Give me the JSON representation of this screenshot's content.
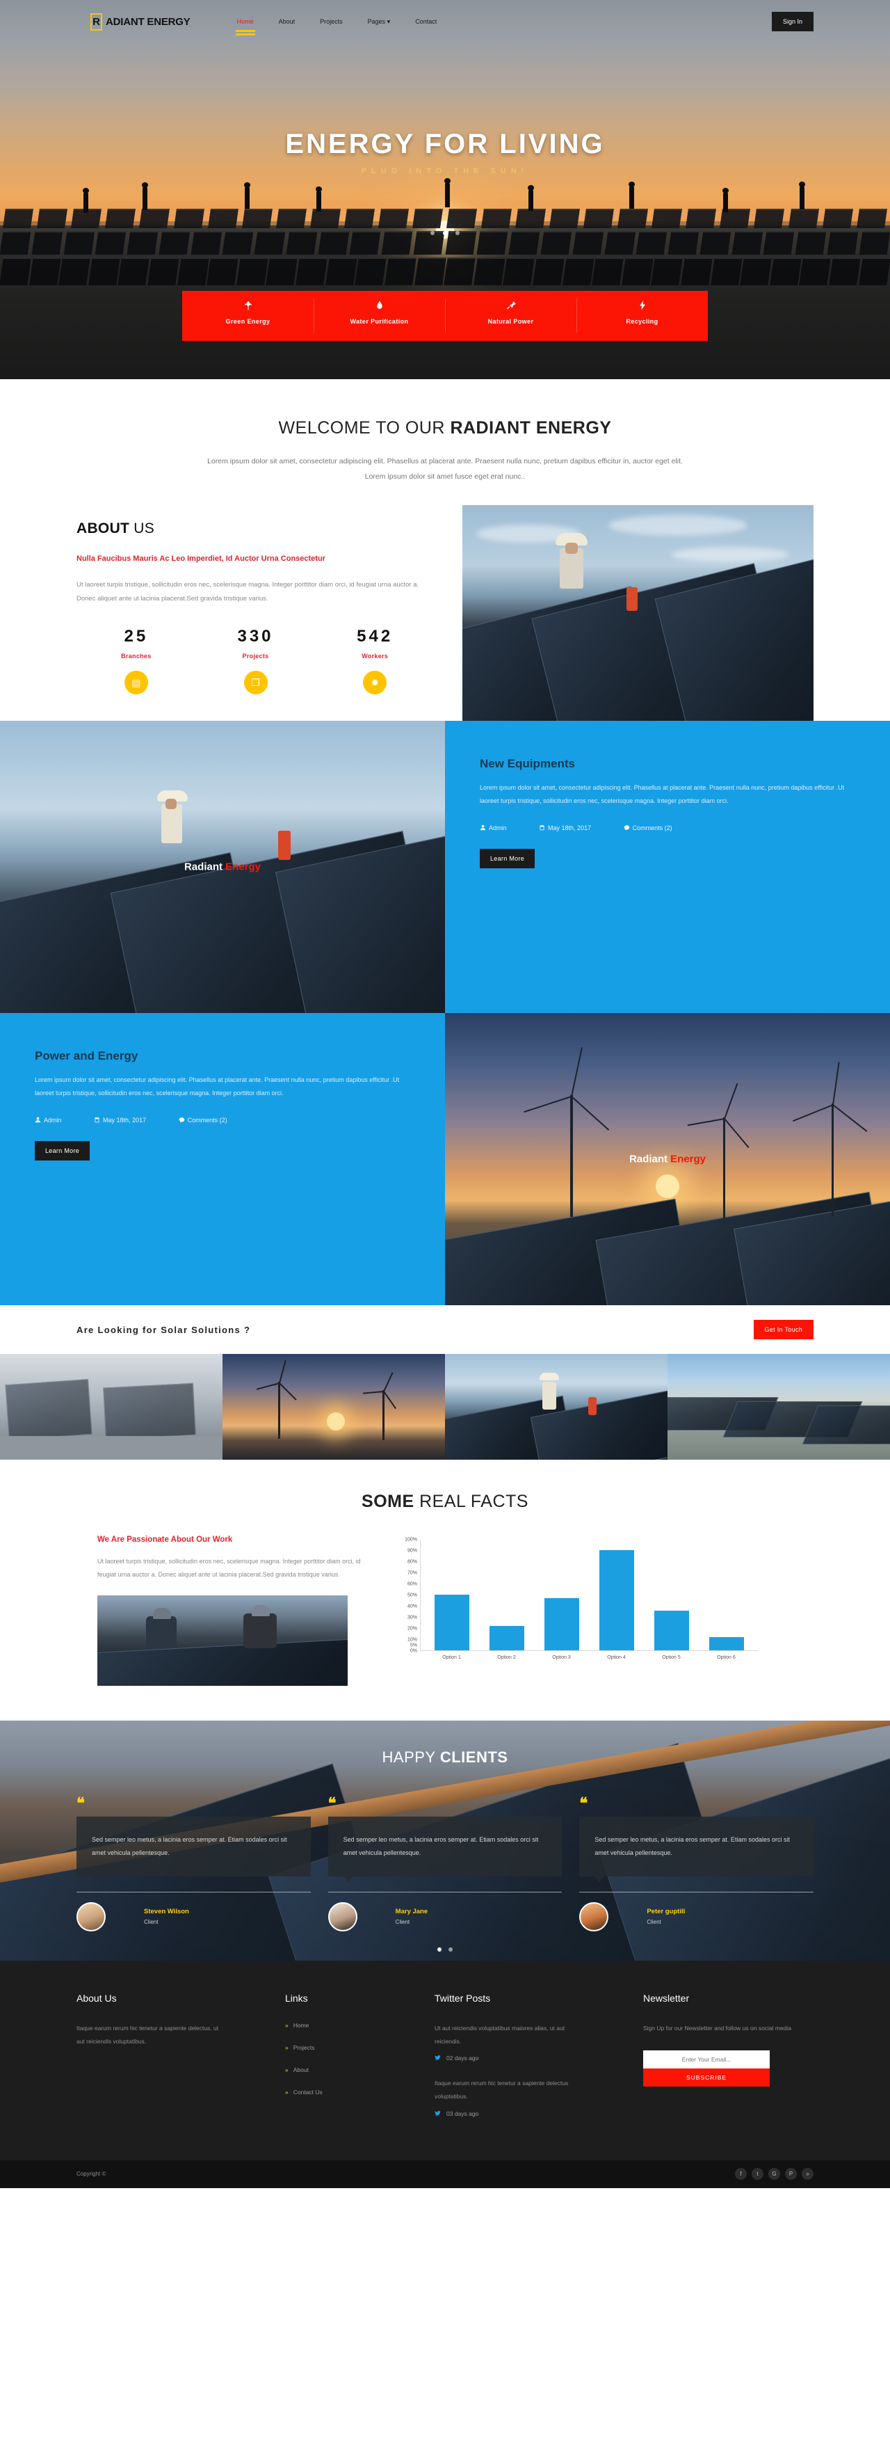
{
  "brand": {
    "initial": "R",
    "rest": "ADIANT ENERGY"
  },
  "nav": {
    "items": [
      {
        "label": "Home",
        "active": true
      },
      {
        "label": "About",
        "active": false
      },
      {
        "label": "Projects",
        "active": false
      },
      {
        "label": "Pages ▾",
        "active": false
      },
      {
        "label": "Contact",
        "active": false
      }
    ],
    "signin": "Sign In"
  },
  "hero": {
    "title": "ENERGY FOR LIVING",
    "subtitle": "PLUG INTO THE SUN!"
  },
  "features": [
    {
      "label": "Green Energy",
      "icon": "leaf-icon"
    },
    {
      "label": "Water Purification",
      "icon": "droplet-icon"
    },
    {
      "label": "Natural Power",
      "icon": "plug-icon"
    },
    {
      "label": "Recycling",
      "icon": "bolt-icon"
    }
  ],
  "welcome": {
    "title_light": "WELCOME TO OUR ",
    "title_bold": "RADIANT ENERGY",
    "body": "Lorem ipsum dolor sit amet, consectetur adipiscing elit. Phasellus at placerat ante. Praesent nulla nunc, pretium dapibus efficitur in, auctor eget elit. Lorem ipsum dolor sit amet fusce eget erat nunc.."
  },
  "about": {
    "title_bold": "ABOUT",
    "title_light": " US",
    "subtitle": "Nulla Faucibus Mauris Ac Leo Imperdiet, Id Auctor Urna Consectetur",
    "body": "Ut laoreet turpis tristique, sollicitudin eros nec, scelerisque magna. Integer porttitor diam orci, id feugiat urna auctor a. Donec aliquet ante ut lacinia placerat.Sed gravida tristique varius.",
    "stats": [
      {
        "number": "25",
        "label": "Branches",
        "icon": "building-icon",
        "glyph": "▤"
      },
      {
        "number": "330",
        "label": "Projects",
        "icon": "briefcase-icon",
        "glyph": "❐"
      },
      {
        "number": "542",
        "label": "Workers",
        "icon": "gear-icon",
        "glyph": "✹"
      }
    ]
  },
  "posts": [
    {
      "title": "New Equipments",
      "body": "Lorem ipsum dolor sit amet, consectetur adipiscing elit. Phasellus at placerat ante. Praesent nulla nunc, pretium dapibus efficitur .Ut laoreet turpis tristique, sollicitudin eros nec, scelerisque magna. Integer porttitor diam orci.",
      "author": "Admin",
      "date": "May 18th, 2017",
      "comments": "Comments (2)",
      "button": "Learn More",
      "image_caption_light": "Radiant ",
      "image_caption_red": "Energy"
    },
    {
      "title": "Power and Energy",
      "body": "Lorem ipsum dolor sit amet, consectetur adipiscing elit. Phasellus at placerat ante. Praesent nulla nunc, pretium dapibus efficitur .Ut laoreet turpis tristique, sollicitudin eros nec, scelerisque magna. Integer porttitor diam orci.",
      "author": "Admin",
      "date": "May 18th, 2017",
      "comments": "Comments (2)",
      "button": "Learn More",
      "image_caption_light": "Radiant ",
      "image_caption_red": "Energy"
    }
  ],
  "cta": {
    "heading": "Are Looking for Solar Solutions ?",
    "button": "Get In Touch"
  },
  "facts": {
    "title_bold": "SOME",
    "title_light": " REAL FACTS",
    "heading": "We Are Passionate About Our Work",
    "body": "Ut laoreet turpis tristique, sollicitudin eros nec, scelerisque magna. Integer porttitor diam orci, id feugiat urna auctor a. Donec aliquet ante ut lacinia placerat.Sed gravida tristique varius."
  },
  "chart_data": {
    "type": "bar",
    "title": "",
    "categories": [
      "Option 1",
      "Option 2",
      "Option 3",
      "Option 4",
      "Option 5",
      "Option 6"
    ],
    "values": [
      50,
      22,
      47,
      90,
      36,
      12
    ],
    "series": [
      {
        "name": "Percentage",
        "values": [
          50,
          22,
          47,
          90,
          36,
          12
        ]
      }
    ],
    "ylabel": "",
    "xlabel": "",
    "ylim": [
      0,
      100
    ],
    "yticks": [
      "100%",
      "90%",
      "80%",
      "70%",
      "60%",
      "50%",
      "40%",
      "30%",
      "20%",
      "10%",
      "5%"
    ],
    "ytick_values": [
      100,
      90,
      80,
      70,
      60,
      50,
      40,
      30,
      20,
      10,
      5
    ],
    "bar_color": "#1c9fe0",
    "grid": false,
    "legend": "none"
  },
  "testimonials": {
    "title_light": "HAPPY ",
    "title_bold": "CLIENTS",
    "quote_glyph": "❝",
    "items": [
      {
        "text": "Sed semper leo metus, a lacinia eros semper at. Etiam sodales orci sit amet vehicula pellentesque.",
        "name": "Steven Wilson",
        "role": "Client"
      },
      {
        "text": "Sed semper leo metus, a lacinia eros semper at. Etiam sodales orci sit amet vehicula pellentesque.",
        "name": "Mary Jane",
        "role": "Client"
      },
      {
        "text": "Sed semper leo metus, a lacinia eros semper at. Etiam sodales orci sit amet vehicula pellentesque.",
        "name": "Peter guptill",
        "role": "Client"
      }
    ]
  },
  "footer": {
    "about": {
      "heading": "About Us",
      "body": "Itaque earum rerum hic tenetur a sapiente delectus, ut aut reiciendis voluptatibus."
    },
    "links": {
      "heading": "Links",
      "items": [
        "Home",
        "Projects",
        "About",
        "Contact Us"
      ]
    },
    "twitter": {
      "heading": "Twitter Posts",
      "posts": [
        {
          "text": "Ut aut reiciendis voluptatibus maiores alias, ut aut reiciendis.",
          "date": "02 days ago"
        },
        {
          "text": "Itaque earum rerum hic tenetur a sapiente delectus voluptatibus.",
          "date": "03 days ago"
        }
      ]
    },
    "newsletter": {
      "heading": "Newsletter",
      "body": "Sign Up for our Newsletter and follow us on social media",
      "placeholder": "Enter Your Email...",
      "button": "SUBSCRIBE"
    },
    "copyright": "Copyright ©",
    "socials": [
      {
        "name": "facebook-icon",
        "glyph": "f"
      },
      {
        "name": "twitter-icon",
        "glyph": "t"
      },
      {
        "name": "google-plus-icon",
        "glyph": "G"
      },
      {
        "name": "pinterest-icon",
        "glyph": "P"
      },
      {
        "name": "rss-icon",
        "glyph": "»"
      }
    ]
  },
  "colors": {
    "accent_red": "#fc1505",
    "accent_blue": "#179fe6",
    "accent_yellow": "#ffc400",
    "dark": "#1d1d1d"
  }
}
